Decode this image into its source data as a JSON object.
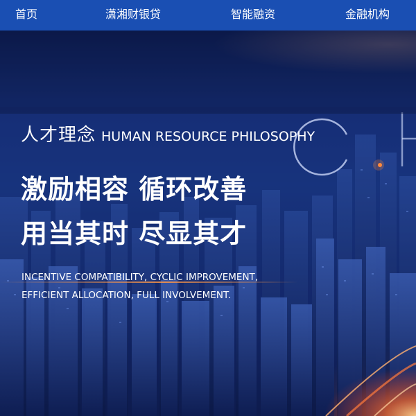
{
  "nav": {
    "items": [
      {
        "label": "首页"
      },
      {
        "label": "潇湘财银贷"
      },
      {
        "label": "智能融资"
      },
      {
        "label": "金融机构"
      }
    ]
  },
  "hero": {
    "title_cn": "人才理念",
    "title_en": "HUMAN RESOURCE PHILOSOPHY",
    "slogan_line1": "激励相容  循环改善",
    "slogan_line2": "用当其时  尽显其才",
    "en_line1": "INCENTIVE COMPATIBILITY, CYCLIC IMPROVEMENT,",
    "en_line2": "EFFICIENT ALLOCATION, FULL INVOLVEMENT.",
    "decorative_letters": "CH"
  },
  "colors": {
    "nav_bg": "#1a4fb3",
    "text": "#ffffff",
    "hero_dark": "#0c1a4d",
    "hero_mid": "#1a3a86",
    "glow": "#ff8a3c"
  }
}
